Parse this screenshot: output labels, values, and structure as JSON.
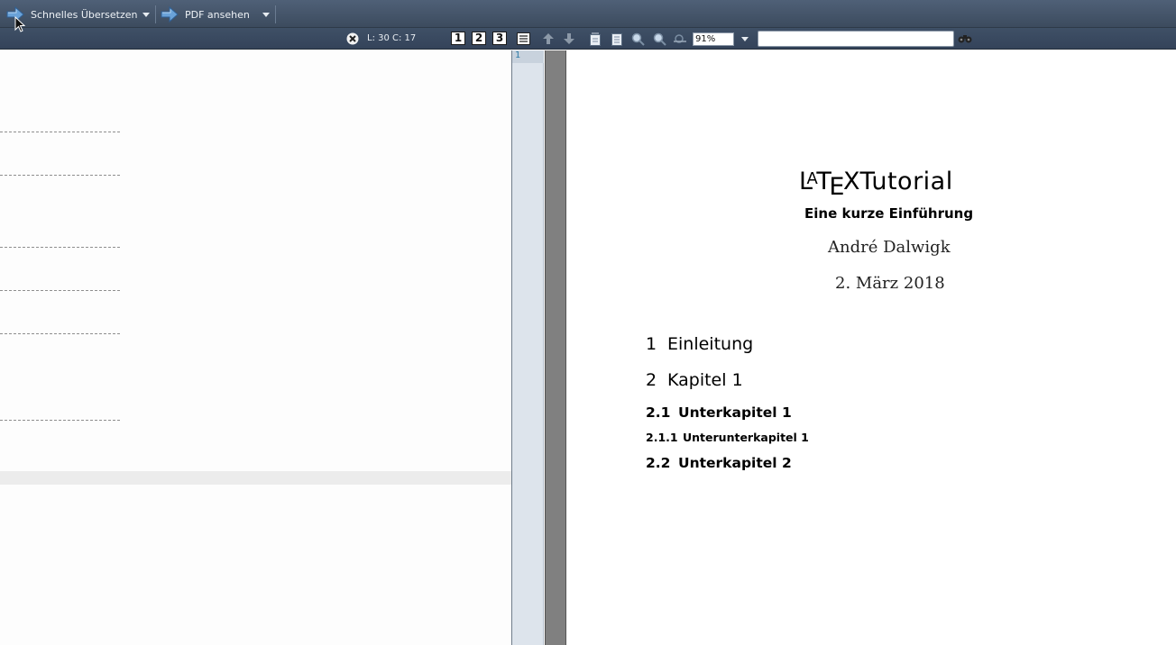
{
  "toolbar": {
    "quick_build_label": "Schnelles Übersetzen",
    "view_pdf_label": "PDF ansehen"
  },
  "statusbar": {
    "cursor_position": "L: 30 C: 17",
    "zoom_value": "91%",
    "search_value": ""
  },
  "view_buttons": [
    "1",
    "2",
    "3"
  ],
  "icons": {
    "quick_build": "arrow-right-icon",
    "view_pdf": "arrow-right-icon",
    "close_editor": "close-icon",
    "structure": "list-icon",
    "prev_page": "arrow-up-icon",
    "next_page": "arrow-down-icon",
    "fit_width": "page-icon",
    "fit_page": "page-icon",
    "zoom_in": "zoom-in-icon",
    "zoom_out": "zoom-out-icon",
    "magnifier": "magnifier-icon",
    "find": "binoculars-icon"
  },
  "pdf": {
    "gutter_page": "1",
    "title_suffix": "Tutorial",
    "subtitle": "Eine kurze Einführung",
    "author": "André Dalwigk",
    "date": "2. März 2018",
    "sections": [
      {
        "num": "1",
        "title": "Einleitung",
        "level": 1
      },
      {
        "num": "2",
        "title": "Kapitel 1",
        "level": 1
      },
      {
        "num": "2.1",
        "title": "Unterkapitel 1",
        "level": 2
      },
      {
        "num": "2.1.1",
        "title": "Unterunterkapitel 1",
        "level": 3
      },
      {
        "num": "2.2",
        "title": "Unterkapitel 2",
        "level": 2
      }
    ]
  },
  "colors": {
    "toolbar_bg": "#4f6077",
    "gutter_bg": "#dde4ec",
    "current_line": "#ececec"
  }
}
